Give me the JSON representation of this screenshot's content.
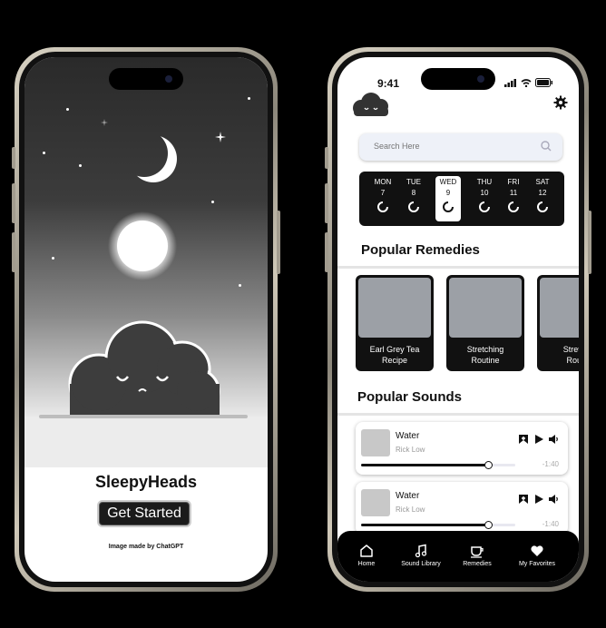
{
  "welcome": {
    "app_name": "SleepyHeads",
    "cta_label": "Get Started",
    "credit": "Image made by ChatGPT"
  },
  "app": {
    "status_time": "9:41",
    "search_placeholder": "Search Here",
    "days": [
      {
        "name": "MON",
        "date": "7",
        "selected": false
      },
      {
        "name": "TUE",
        "date": "8",
        "selected": false
      },
      {
        "name": "WED",
        "date": "9",
        "selected": true
      },
      {
        "name": "THU",
        "date": "10",
        "selected": false
      },
      {
        "name": "FRI",
        "date": "11",
        "selected": false
      },
      {
        "name": "SAT",
        "date": "12",
        "selected": false
      }
    ],
    "remedies_title": "Popular Remedies",
    "remedies": [
      {
        "line1": "Earl Grey Tea",
        "line2": "Recipe"
      },
      {
        "line1": "Stretching",
        "line2": "Routine"
      },
      {
        "line1": "Stretch",
        "line2": "Routi"
      }
    ],
    "sounds_title": "Popular Sounds",
    "sounds": [
      {
        "title": "Water",
        "artist": "Rick Low",
        "time": "-1:40",
        "progress": 0.82
      },
      {
        "title": "Water",
        "artist": "Rick Low",
        "time": "-1:40",
        "progress": 0.82
      }
    ],
    "tabs": [
      {
        "label": "Home",
        "icon": "home-icon"
      },
      {
        "label": "Sound Library",
        "icon": "music-icon"
      },
      {
        "label": "Remedies",
        "icon": "cup-icon"
      },
      {
        "label": "My Favorites",
        "icon": "heart-icon"
      }
    ]
  }
}
